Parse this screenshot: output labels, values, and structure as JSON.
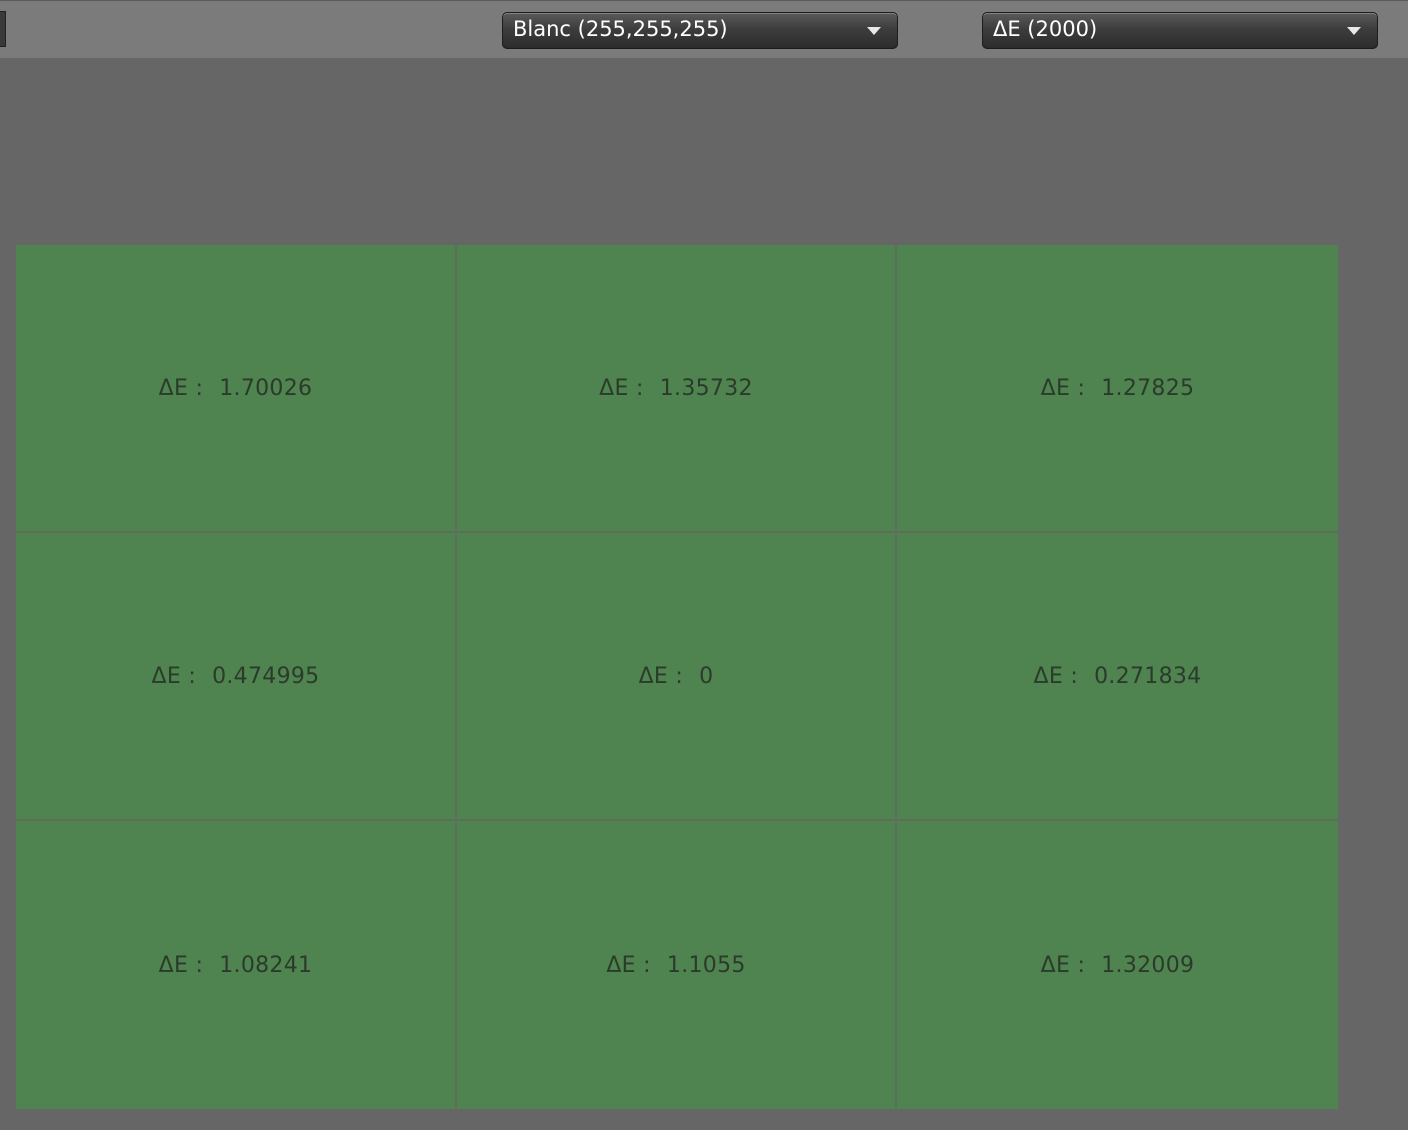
{
  "toolbar": {
    "reference_dropdown": {
      "selected": "Blanc (255,255,255)"
    },
    "metric_dropdown": {
      "selected": "ΔE (2000)"
    }
  },
  "grid": {
    "prefix": "ΔE :",
    "cells": [
      {
        "value": "1.70026"
      },
      {
        "value": "1.35732"
      },
      {
        "value": "1.27825"
      },
      {
        "value": "0.474995"
      },
      {
        "value": "0"
      },
      {
        "value": "0.271834"
      },
      {
        "value": "1.08241"
      },
      {
        "value": "1.1055"
      },
      {
        "value": "1.32009"
      }
    ],
    "cell_color": "#4f834f"
  },
  "icons": {
    "dropdown_caret": "chevron-down-icon"
  }
}
